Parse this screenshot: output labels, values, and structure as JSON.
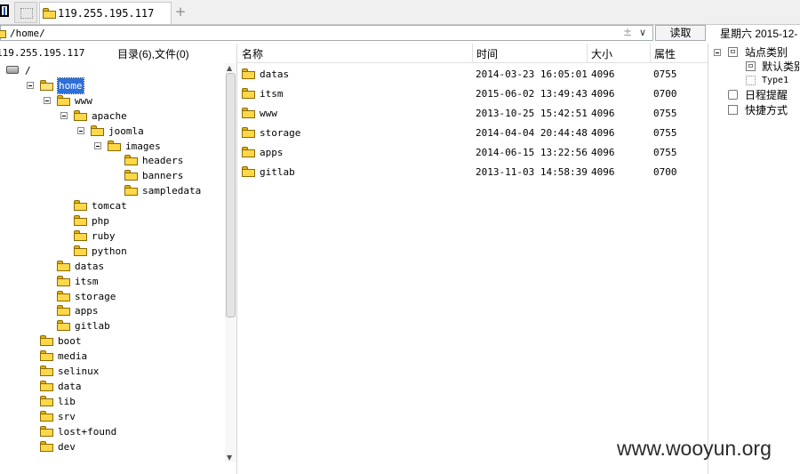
{
  "tabs": {
    "active_label": "119.255.195.117",
    "add_label": "+"
  },
  "pathbar": {
    "path": "/home/",
    "plusminus": "±",
    "dropdown": "∨",
    "read_label": "读取",
    "date_text": "星期六 2015-12-"
  },
  "left_panel": {
    "host": "119.255.195.117",
    "counts": "目录(6),文件(0)",
    "tree": [
      {
        "name": "/",
        "depth": 0,
        "toggle": false,
        "icon": "drive-icon"
      },
      {
        "name": "home",
        "depth": 1,
        "toggle": true,
        "icon": "folder-open-icon",
        "selected": true
      },
      {
        "name": "www",
        "depth": 2,
        "toggle": true,
        "icon": "folder-icon"
      },
      {
        "name": "apache",
        "depth": 3,
        "toggle": true,
        "icon": "folder-icon"
      },
      {
        "name": "joomla",
        "depth": 4,
        "toggle": true,
        "icon": "folder-icon"
      },
      {
        "name": "images",
        "depth": 5,
        "toggle": true,
        "icon": "folder-icon"
      },
      {
        "name": "headers",
        "depth": 6,
        "toggle": false,
        "icon": "folder-icon"
      },
      {
        "name": "banners",
        "depth": 6,
        "toggle": false,
        "icon": "folder-icon"
      },
      {
        "name": "sampledata",
        "depth": 6,
        "toggle": false,
        "icon": "folder-icon"
      },
      {
        "name": "tomcat",
        "depth": 3,
        "toggle": false,
        "icon": "folder-icon"
      },
      {
        "name": "php",
        "depth": 3,
        "toggle": false,
        "icon": "folder-icon"
      },
      {
        "name": "ruby",
        "depth": 3,
        "toggle": false,
        "icon": "folder-icon"
      },
      {
        "name": "python",
        "depth": 3,
        "toggle": false,
        "icon": "folder-icon"
      },
      {
        "name": "datas",
        "depth": 2,
        "toggle": false,
        "icon": "folder-icon"
      },
      {
        "name": "itsm",
        "depth": 2,
        "toggle": false,
        "icon": "folder-icon"
      },
      {
        "name": "storage",
        "depth": 2,
        "toggle": false,
        "icon": "folder-icon"
      },
      {
        "name": "apps",
        "depth": 2,
        "toggle": false,
        "icon": "folder-icon"
      },
      {
        "name": "gitlab",
        "depth": 2,
        "toggle": false,
        "icon": "folder-icon"
      },
      {
        "name": "boot",
        "depth": 1,
        "toggle": false,
        "icon": "folder-icon"
      },
      {
        "name": "media",
        "depth": 1,
        "toggle": false,
        "icon": "folder-icon"
      },
      {
        "name": "selinux",
        "depth": 1,
        "toggle": false,
        "icon": "folder-icon"
      },
      {
        "name": "data",
        "depth": 1,
        "toggle": false,
        "icon": "folder-icon"
      },
      {
        "name": "lib",
        "depth": 1,
        "toggle": false,
        "icon": "folder-icon"
      },
      {
        "name": "srv",
        "depth": 1,
        "toggle": false,
        "icon": "folder-icon"
      },
      {
        "name": "lost+found",
        "depth": 1,
        "toggle": false,
        "icon": "folder-icon"
      },
      {
        "name": "dev",
        "depth": 1,
        "toggle": false,
        "icon": "folder-icon"
      }
    ]
  },
  "file_list": {
    "columns": {
      "name": "名称",
      "time": "时间",
      "size": "大小",
      "attr": "属性"
    },
    "rows": [
      {
        "name": "datas",
        "time": "2014-03-23 16:05:01",
        "size": "4096",
        "attr": "0755"
      },
      {
        "name": "itsm",
        "time": "2015-06-02 13:49:43",
        "size": "4096",
        "attr": "0700"
      },
      {
        "name": "www",
        "time": "2013-10-25 15:42:51",
        "size": "4096",
        "attr": "0755"
      },
      {
        "name": "storage",
        "time": "2014-04-04 20:44:48",
        "size": "4096",
        "attr": "0755"
      },
      {
        "name": "apps",
        "time": "2014-06-15 13:22:56",
        "size": "4096",
        "attr": "0755"
      },
      {
        "name": "gitlab",
        "time": "2013-11-03 14:58:39",
        "size": "4096",
        "attr": "0700"
      }
    ]
  },
  "right_panel": {
    "site_category": "站点类别",
    "default_category": "默认类别",
    "type1": "Type1",
    "schedule": "日程提醒",
    "shortcuts": "快捷方式"
  },
  "watermark": "www.wooyun.org",
  "colors": {
    "selection": "#2e6fd8",
    "folder": "#ffd84a"
  }
}
